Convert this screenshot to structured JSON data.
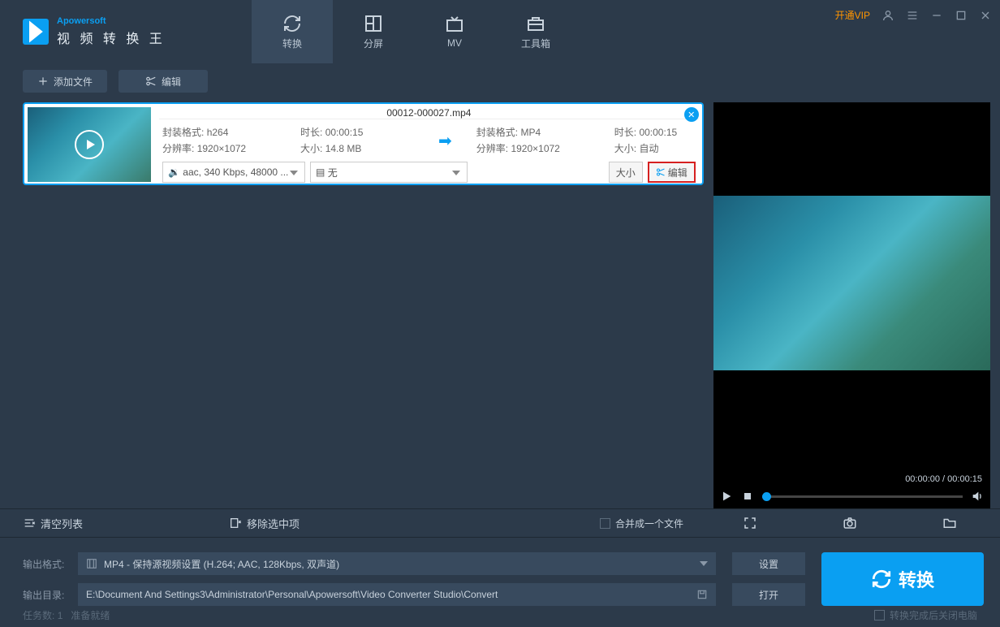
{
  "titlebar": {
    "brand": "Apowersoft",
    "title": "视 频 转 换 王",
    "vip": "开通VIP"
  },
  "tabs": {
    "convert": "转换",
    "split": "分屏",
    "mv": "MV",
    "toolbox": "工具箱"
  },
  "toolbar": {
    "add": "添加文件",
    "edit": "编辑"
  },
  "file": {
    "name": "00012-000027.mp4",
    "src_codec_label": "封装格式:",
    "src_codec": "h264",
    "src_dur_label": "时长:",
    "src_dur": "00:00:15",
    "src_res_label": "分辨率:",
    "src_res": "1920×1072",
    "src_size_label": "大小:",
    "src_size": "14.8 MB",
    "dst_codec_label": "封装格式:",
    "dst_codec": "MP4",
    "dst_dur_label": "时长:",
    "dst_dur": "00:00:15",
    "dst_res_label": "分辨率:",
    "dst_res": "1920×1072",
    "dst_size_label": "大小:",
    "dst_size": "自动",
    "audio_sel": "aac, 340 Kbps, 48000 ...",
    "sub_sel": "无",
    "size_btn": "大小",
    "edit_btn": "编辑"
  },
  "preview": {
    "time": "00:00:00 / 00:00:15"
  },
  "actions": {
    "clear": "清空列表",
    "remove": "移除选中项",
    "merge": "合并成一个文件"
  },
  "output": {
    "format_label": "输出格式:",
    "format_value": "MP4 - 保持源视频设置 (H.264; AAC, 128Kbps, 双声道)",
    "dir_label": "输出目录:",
    "dir_value": "E:\\Document And Settings3\\Administrator\\Personal\\Apowersoft\\Video Converter Studio\\Convert",
    "settings": "设置",
    "open": "打开",
    "convert": "转换"
  },
  "status": {
    "tasks_label": "任务数:",
    "tasks": "1",
    "ready": "准备就绪",
    "shutdown": "转换完成后关闭电脑"
  }
}
